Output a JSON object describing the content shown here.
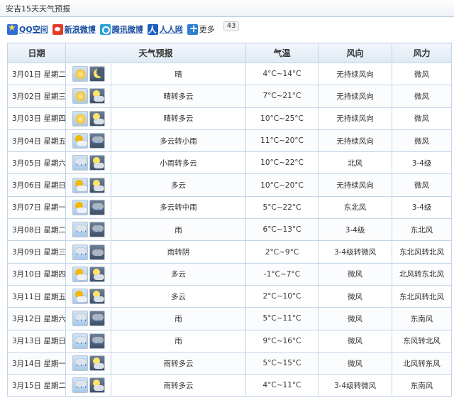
{
  "page_title": "安吉15天天气预报",
  "share": {
    "items": [
      {
        "label": "QQ空间",
        "icon": "qzone-icon"
      },
      {
        "label": "新浪微博",
        "icon": "weibo-icon"
      },
      {
        "label": "腾讯微博",
        "icon": "tencent-weibo-icon"
      },
      {
        "label": "人人网",
        "icon": "renren-icon"
      },
      {
        "label": "更多",
        "icon": "plus-icon"
      }
    ],
    "count": "43"
  },
  "table": {
    "headers": {
      "date": "日期",
      "forecast": "天气预报",
      "temp": "气温",
      "wind_dir": "风向",
      "wind_force": "风力"
    },
    "rows": [
      {
        "date": "3月01日 星期二",
        "day_icon": "sun-icon",
        "night_icon": "moon-icon",
        "weather": "晴",
        "temp": "4°C~14°C",
        "wind_dir": "无持续风向",
        "wind_force": "微风"
      },
      {
        "date": "3月02日 星期三",
        "day_icon": "sun-icon",
        "night_icon": "moon-cloud-icon",
        "weather": "晴转多云",
        "temp": "7°C~21°C",
        "wind_dir": "无持续风向",
        "wind_force": "微风"
      },
      {
        "date": "3月03日 星期四",
        "day_icon": "sun-icon",
        "night_icon": "moon-cloud-icon",
        "weather": "晴转多云",
        "temp": "10°C~25°C",
        "wind_dir": "无持续风向",
        "wind_force": "微风"
      },
      {
        "date": "3月04日 星期五",
        "day_icon": "partly-cloudy-icon",
        "night_icon": "rain-icon",
        "weather": "多云转小雨",
        "temp": "11°C~20°C",
        "wind_dir": "无持续风向",
        "wind_force": "微风"
      },
      {
        "date": "3月05日 星期六",
        "day_icon": "rain-icon",
        "night_icon": "moon-cloud-icon",
        "weather": "小雨转多云",
        "temp": "10°C~22°C",
        "wind_dir": "北风",
        "wind_force": "3-4级"
      },
      {
        "date": "3月06日 星期日",
        "day_icon": "partly-cloudy-icon",
        "night_icon": "moon-cloud-icon",
        "weather": "多云",
        "temp": "10°C~20°C",
        "wind_dir": "无持续风向",
        "wind_force": "微风"
      },
      {
        "date": "3月07日 星期一",
        "day_icon": "partly-cloudy-icon",
        "night_icon": "rain-icon",
        "weather": "多云转中雨",
        "temp": "5°C~22°C",
        "wind_dir": "东北风",
        "wind_force": "3-4级"
      },
      {
        "date": "3月08日 星期二",
        "day_icon": "rain-icon",
        "night_icon": "rain-icon",
        "weather": "雨",
        "temp": "6°C~13°C",
        "wind_dir": "3-4级",
        "wind_force": "东北风"
      },
      {
        "date": "3月09日 星期三",
        "day_icon": "rain-icon",
        "night_icon": "cloud-icon",
        "weather": "雨转阴",
        "temp": "2°C~9°C",
        "wind_dir": "3-4级转微风",
        "wind_force": "东北风转北风"
      },
      {
        "date": "3月10日 星期四",
        "day_icon": "partly-cloudy-icon",
        "night_icon": "moon-cloud-icon",
        "weather": "多云",
        "temp": "-1°C~7°C",
        "wind_dir": "微风",
        "wind_force": "北风转东北风"
      },
      {
        "date": "3月11日 星期五",
        "day_icon": "partly-cloudy-icon",
        "night_icon": "moon-cloud-icon",
        "weather": "多云",
        "temp": "2°C~10°C",
        "wind_dir": "微风",
        "wind_force": "东北风转北风"
      },
      {
        "date": "3月12日 星期六",
        "day_icon": "rain-icon",
        "night_icon": "rain-icon",
        "weather": "雨",
        "temp": "5°C~11°C",
        "wind_dir": "微风",
        "wind_force": "东南风"
      },
      {
        "date": "3月13日 星期日",
        "day_icon": "rain-icon",
        "night_icon": "rain-icon",
        "weather": "雨",
        "temp": "9°C~16°C",
        "wind_dir": "微风",
        "wind_force": "东风转北风"
      },
      {
        "date": "3月14日 星期一",
        "day_icon": "rain-icon",
        "night_icon": "moon-cloud-icon",
        "weather": "雨转多云",
        "temp": "5°C~15°C",
        "wind_dir": "微风",
        "wind_force": "北风转东风"
      },
      {
        "date": "3月15日 星期二",
        "day_icon": "rain-icon",
        "night_icon": "moon-cloud-icon",
        "weather": "雨转多云",
        "temp": "4°C~11°C",
        "wind_dir": "3-4级转微风",
        "wind_force": "东南风"
      }
    ]
  }
}
